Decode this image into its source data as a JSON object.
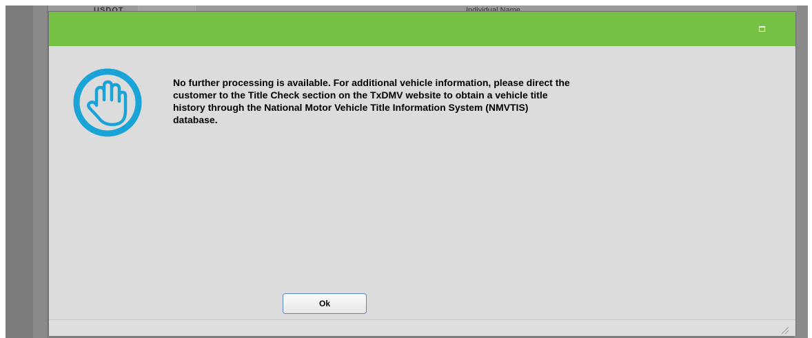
{
  "background": {
    "left_text": "USDOT",
    "right_text": "Individual Name"
  },
  "dialog": {
    "header_color": "#76c043",
    "icon": "stop-hand-icon",
    "icon_color": "#1aa3d6",
    "message": "No further processing is available. For additional vehicle information, please direct the customer to the Title Check section on the TxDMV website to obtain a vehicle title history through the National Motor Vehicle Title Information System (NMVTIS) database.",
    "ok_label": "Ok"
  }
}
